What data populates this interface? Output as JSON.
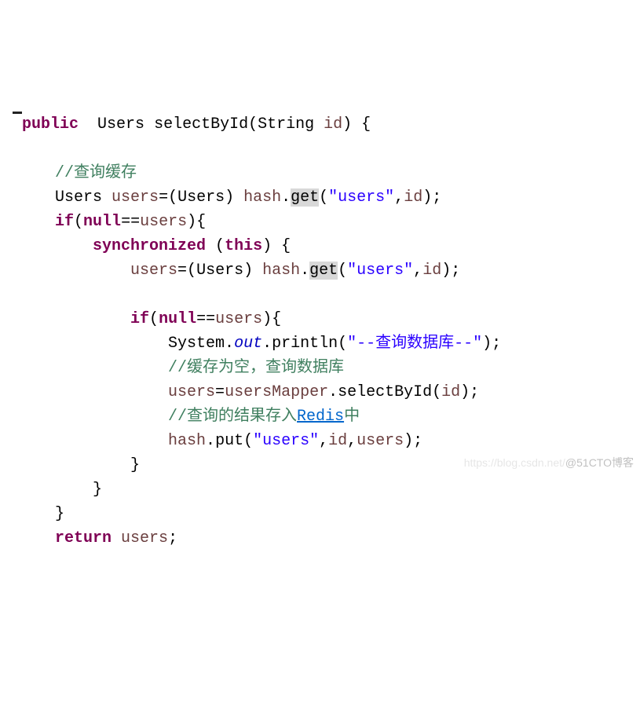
{
  "code": {
    "l1": {
      "kw_public": "public",
      "type": "Users",
      "method": "selectById",
      "param_type": "String",
      "param_name": "id"
    },
    "l2": {
      "comment": "//查询缓存"
    },
    "l3": {
      "type": "Users",
      "var": "users",
      "cast": "Users",
      "obj": "hash",
      "call": "get",
      "arg1": "\"users\"",
      "arg2": "id"
    },
    "l4": {
      "kw_if": "if",
      "kw_null": "null",
      "var": "users"
    },
    "l5": {
      "kw_sync": "synchronized",
      "kw_this": "this"
    },
    "l6": {
      "var": "users",
      "cast": "Users",
      "obj": "hash",
      "call": "get",
      "arg1": "\"users\"",
      "arg2": "id"
    },
    "l7": {
      "kw_if": "if",
      "kw_null": "null",
      "var": "users"
    },
    "l8": {
      "sys": "System",
      "out": "out",
      "println": "println",
      "str": "\"--查询数据库--\""
    },
    "l9": {
      "comment": "//缓存为空，查询数据库"
    },
    "l10": {
      "var": "users",
      "mapper": "usersMapper",
      "call": "selectById",
      "arg": "id"
    },
    "l11": {
      "comment_pre": "//查询的结果存入",
      "link": "Redis",
      "comment_post": "中"
    },
    "l12": {
      "obj": "hash",
      "call": "put",
      "arg1": "\"users\"",
      "arg2": "id",
      "arg3": "users"
    },
    "l13": {
      "kw_return": "return",
      "var": "users"
    }
  },
  "watermark": {
    "faint": "https://blog.csdn.net/",
    "text": "@51CTO博客"
  }
}
